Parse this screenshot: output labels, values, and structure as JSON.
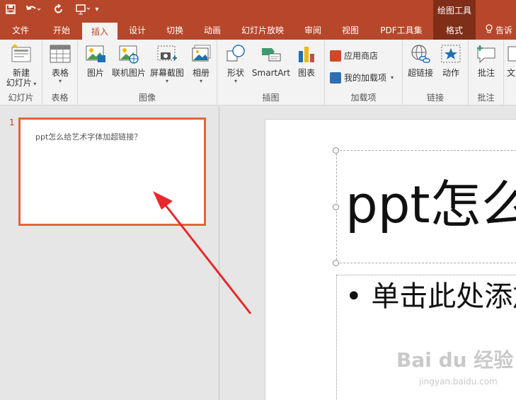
{
  "app": {
    "context_group_label": "绘图工具"
  },
  "tabs": {
    "file": "文件",
    "home": "开始",
    "insert": "插入",
    "design": "设计",
    "transitions": "切换",
    "animations": "动画",
    "slideshow": "幻灯片放映",
    "review": "审阅",
    "view": "视图",
    "pdf_tools": "PDF工具集",
    "format": "格式",
    "tell_me": "告诉"
  },
  "ribbon": {
    "slides": {
      "new_slide_line1": "新建",
      "new_slide_line2": "幻灯片",
      "group": "幻灯片"
    },
    "tables": {
      "table": "表格",
      "group": "表格"
    },
    "images": {
      "picture": "图片",
      "online_picture": "联机图片",
      "screenshot": "屏幕截图",
      "album": "相册",
      "group": "图像"
    },
    "illustrations": {
      "shapes": "形状",
      "smartart": "SmartArt",
      "chart": "图表",
      "group": "插图"
    },
    "addins": {
      "store": "应用商店",
      "my_addins": "我的加载项",
      "group": "加载项"
    },
    "links": {
      "hyperlink": "超链接",
      "action": "动作",
      "group": "链接"
    },
    "comments": {
      "comment": "批注",
      "group": "批注"
    },
    "text": {
      "text_partial": "文"
    }
  },
  "thumbnails": [
    {
      "number": "1",
      "title": "ppt怎么给艺术字体加超链接？"
    }
  ],
  "slide": {
    "title": "ppt怎么给艺术字体加超链接？",
    "body_bullet": "单击此处添加文本"
  },
  "watermark": {
    "brand": "Bai du 经验",
    "url": "jingyan.baidu.com"
  },
  "colors": {
    "accent": "#b7472a",
    "context_tab": "#7f2e18",
    "selection_border": "#e3643a",
    "arrow": "#e8282b"
  }
}
